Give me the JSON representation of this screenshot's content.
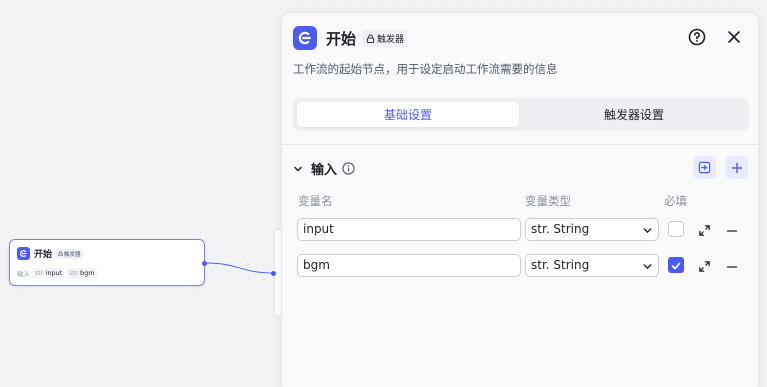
{
  "node": {
    "title": "开始",
    "badge": "触发器",
    "inputs_label": "输入",
    "vars": [
      {
        "type": "str",
        "name": "input"
      },
      {
        "type": "str",
        "name": "bgm"
      }
    ]
  },
  "panel": {
    "title": "开始",
    "badge": "触发器",
    "description": "工作流的起始节点，用于设定启动工作流需要的信息",
    "tabs": [
      {
        "label": "基础设置",
        "active": true
      },
      {
        "label": "触发器设置",
        "active": false
      }
    ],
    "section_title": "输入",
    "columns": {
      "name": "变量名",
      "type": "变量类型",
      "required": "必填"
    },
    "rows": [
      {
        "name": "input",
        "type": "str. String",
        "required": false
      },
      {
        "name": "bgm",
        "type": "str. String",
        "required": true
      }
    ]
  },
  "icons": {
    "logo": "start-logo-icon",
    "help": "help-circle-icon",
    "close": "close-icon",
    "collapse": "chevron-down-icon",
    "info": "info-icon",
    "import": "import-icon",
    "add": "plus-icon",
    "expand": "expand-icon",
    "remove": "minus-icon"
  },
  "colors": {
    "accent": "#4e5bf0",
    "accent_light": "#e8eafd"
  }
}
